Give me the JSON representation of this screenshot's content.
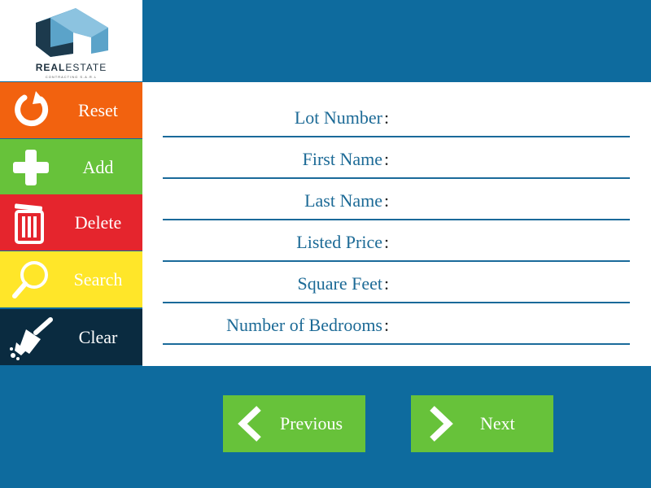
{
  "logo": {
    "brand_bold": "REAL",
    "brand_thin": "ESTATE",
    "tagline": "CONTRACTING S.A.R.L"
  },
  "sidebar": {
    "items": [
      {
        "label": "Reset",
        "icon": "reset-icon",
        "color": "#f2620f"
      },
      {
        "label": "Add",
        "icon": "plus-icon",
        "color": "#67c23a"
      },
      {
        "label": "Delete",
        "icon": "trash-icon",
        "color": "#e5252d"
      },
      {
        "label": "Search",
        "icon": "magnifier-icon",
        "color": "#ffe629"
      },
      {
        "label": "Clear",
        "icon": "broom-icon",
        "color": "#0a2b40"
      }
    ]
  },
  "form": {
    "colon": ":",
    "fields": [
      {
        "label": "Lot Number",
        "value": ""
      },
      {
        "label": "First Name",
        "value": ""
      },
      {
        "label": "Last Name",
        "value": ""
      },
      {
        "label": "Listed Price",
        "value": ""
      },
      {
        "label": "Square Feet",
        "value": ""
      },
      {
        "label": "Number of Bedrooms",
        "value": ""
      }
    ]
  },
  "nav": {
    "previous_label": "Previous",
    "next_label": "Next",
    "color": "#67c23a"
  },
  "colors": {
    "background": "#0e6b9e",
    "label_text": "#1c6a96",
    "field_underline": "#1a6a9a"
  }
}
